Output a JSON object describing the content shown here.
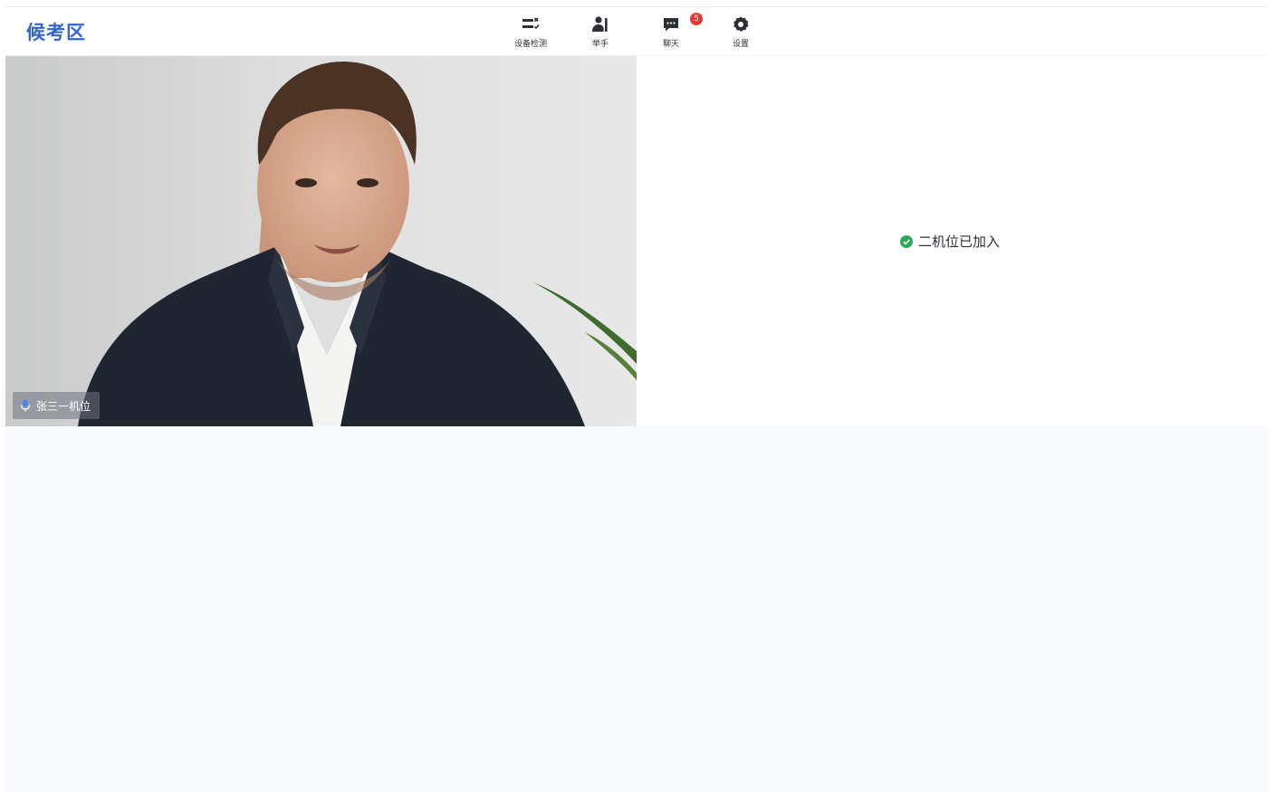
{
  "header": {
    "title": "候考区",
    "accent_color": "#2f64d2"
  },
  "toolbar": [
    {
      "label": "设备检测",
      "icon": "device-check-icon"
    },
    {
      "label": "举手",
      "icon": "raise-hand-icon"
    },
    {
      "label": "聊天",
      "icon": "chat-icon",
      "badge": "5",
      "badge_color": "#e53935"
    },
    {
      "label": "设置",
      "icon": "gear-icon"
    }
  ],
  "video_main": {
    "camera_label": "张三一机位",
    "mic_icon": "microphone-icon"
  },
  "video_second": {
    "status_text": "二机位已加入",
    "status_icon": "check-circle-icon",
    "status_color": "#2fa75a"
  }
}
